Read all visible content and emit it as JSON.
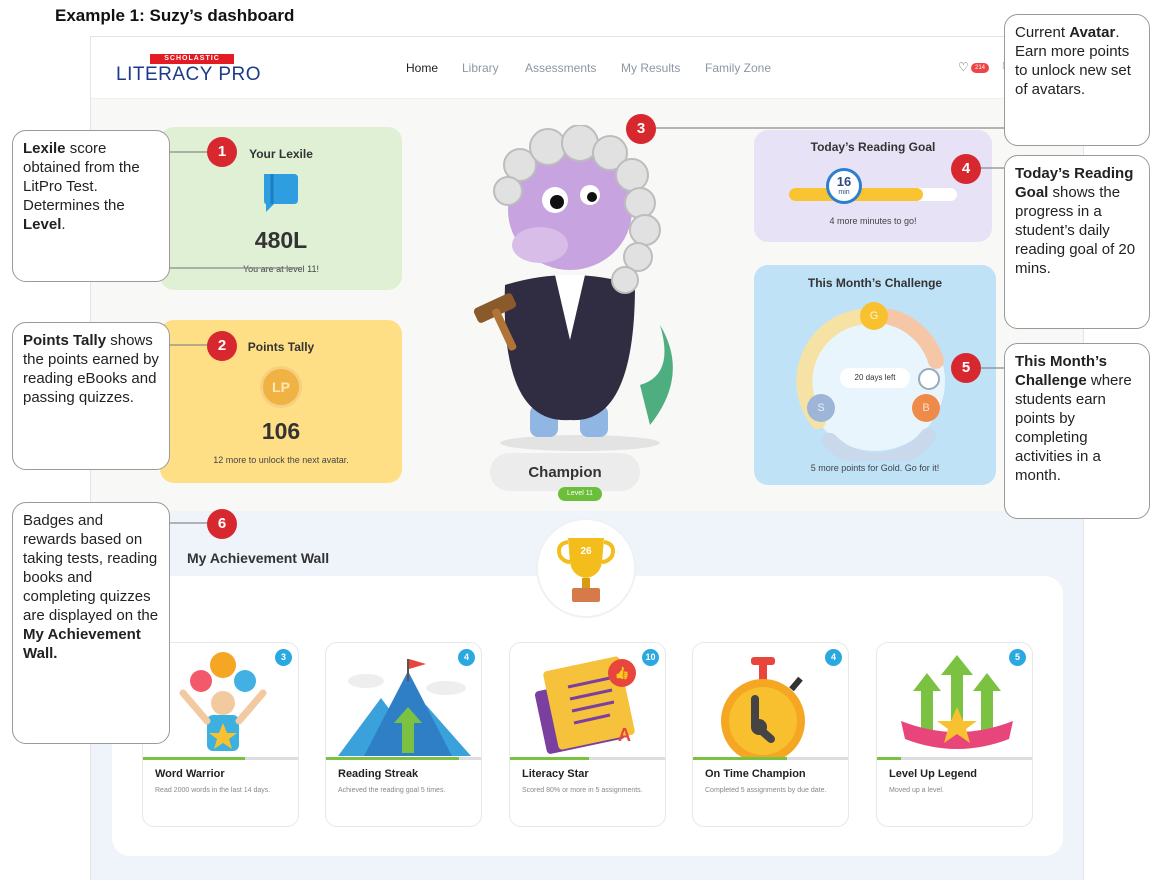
{
  "page_title": "Example 1: Suzy’s dashboard",
  "brand": {
    "top": "SCHOLASTIC",
    "name": "LITERACY PRO"
  },
  "nav": [
    "Home",
    "Library",
    "Assessments",
    "My Results",
    "Family Zone"
  ],
  "header": {
    "heart_count": "214"
  },
  "lexile": {
    "title": "Your Lexile",
    "score": "480L",
    "level_text": "You are at level 11!"
  },
  "points": {
    "title": "Points Tally",
    "coin": "LP",
    "value": "106",
    "note": "12 more to unlock the next avatar."
  },
  "avatar": {
    "name": "Champion",
    "level": "Level 11"
  },
  "goal": {
    "title": "Today’s Reading Goal",
    "minutes": "16",
    "unit": "min",
    "note": "4 more minutes to go!",
    "progress": 0.8
  },
  "challenge": {
    "title": "This Month’s Challenge",
    "days_left": "20 days left",
    "note": "5 more points for Gold. Go for it!",
    "medals": {
      "g": "G",
      "s": "S",
      "b": "B"
    }
  },
  "achievements": {
    "title": "My Achievement Wall",
    "trophy_count": "26",
    "items": [
      {
        "name": "Word Warrior",
        "desc": "Read 2000 words in the last 14 days.",
        "count": "3",
        "progress": 0.65
      },
      {
        "name": "Reading Streak",
        "desc": "Achieved the reading goal 5 times.",
        "count": "4",
        "progress": 0.85
      },
      {
        "name": "Literacy Star",
        "desc": "Scored 80% or more in 5 assignments.",
        "count": "10",
        "progress": 0.5
      },
      {
        "name": "On Time Champion",
        "desc": "Completed 5 assignments by due date.",
        "count": "4",
        "progress": 0.6
      },
      {
        "name": "Level Up Legend",
        "desc": "Moved up a level.",
        "count": "5",
        "progress": 0.15
      }
    ]
  },
  "callouts": {
    "c1": {
      "num": "1",
      "b1": "Lexile",
      "t1": " score obtained from the LitPro Test. Determines the ",
      "b2": "Level",
      "t2": "."
    },
    "c2": {
      "num": "2",
      "b1": "Points Tally",
      "t1": " shows the points earned by reading eBooks and passing quizzes."
    },
    "c3": {
      "num": "3",
      "t0": "Current ",
      "b1": "Avatar",
      "t1": ". Earn more points to unlock new set of avatars."
    },
    "c4": {
      "num": "4",
      "b1": "Today’s Reading Goal",
      "t1": " shows the progress in a student’s daily reading goal of 20 mins."
    },
    "c5": {
      "num": "5",
      "b1": "This Month’s Challenge",
      "t1": " where students earn points by completing activities in a month."
    },
    "c6": {
      "num": "6",
      "t1": "Badges and rewards based on taking tests, reading books and completing quizzes are displayed on the ",
      "b1": "My Achievement Wall."
    }
  }
}
